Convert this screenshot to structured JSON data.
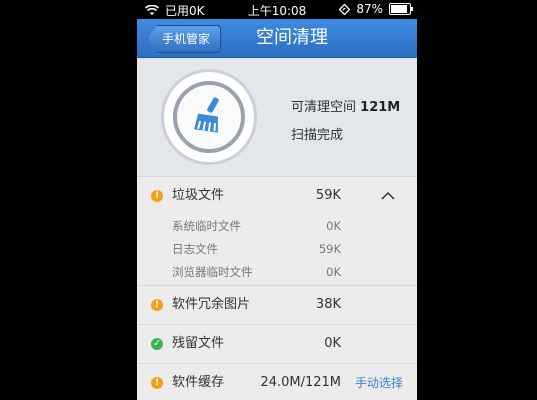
{
  "statusbar": {
    "carrier": "已用0K",
    "time": "上午10:08",
    "battery": "87%",
    "battery_level": 0.87
  },
  "titlebar": {
    "back_label": "手机管家",
    "title": "空间清理"
  },
  "summary": {
    "cleanable_label": "可清理空间",
    "cleanable_value": "121M",
    "scan_status": "扫描完成",
    "icon": "broom-icon"
  },
  "items": [
    {
      "label": "垃圾文件",
      "value": "59K",
      "status": "warn",
      "children": [
        {
          "label": "系统临时文件",
          "value": "0K"
        },
        {
          "label": "日志文件",
          "value": "59K"
        },
        {
          "label": "浏览器临时文件",
          "value": "0K"
        }
      ]
    },
    {
      "label": "软件冗余图片",
      "value": "38K",
      "status": "warn"
    },
    {
      "label": "残留文件",
      "value": "0K",
      "status": "ok"
    },
    {
      "label": "软件缓存",
      "value": "24.0M/121M",
      "status": "warn",
      "action": "手动选择"
    }
  ],
  "colors": {
    "accent": "#2b6fc2",
    "warn": "#f3a018",
    "ok": "#3bb54a",
    "link": "#3b82d0"
  }
}
